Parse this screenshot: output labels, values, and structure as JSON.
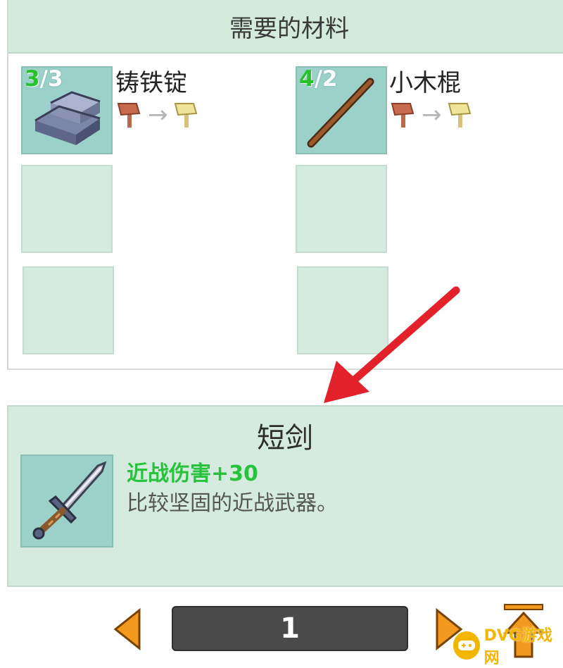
{
  "materials": {
    "header": "需要的材料",
    "items": [
      {
        "have": "3",
        "sep": "/",
        "need": "3",
        "name": "铸铁锭",
        "icon": "iron-ingot-icon"
      },
      {
        "have": "4",
        "sep": "/",
        "need": "2",
        "name": "小木棍",
        "icon": "wooden-stick-icon"
      }
    ],
    "tool_transform": {
      "from": "copper-axe-icon",
      "arrow": "→",
      "to": "gold-axe-icon"
    }
  },
  "result": {
    "name": "短剑",
    "icon": "short-sword-icon",
    "stat": "近战伤害+30",
    "description": "比较坚固的近战武器。"
  },
  "pager": {
    "page": "1"
  },
  "watermark": {
    "text": "DVG游戏网"
  },
  "colors": {
    "accent_green": "#26c22b",
    "panel_bg": "#d4eadb",
    "slot_filled": "#9bd1c8",
    "slot_empty": "#d6ebe0",
    "pager_arrow": "#f39a1e",
    "annotation_red": "#e2212b"
  }
}
